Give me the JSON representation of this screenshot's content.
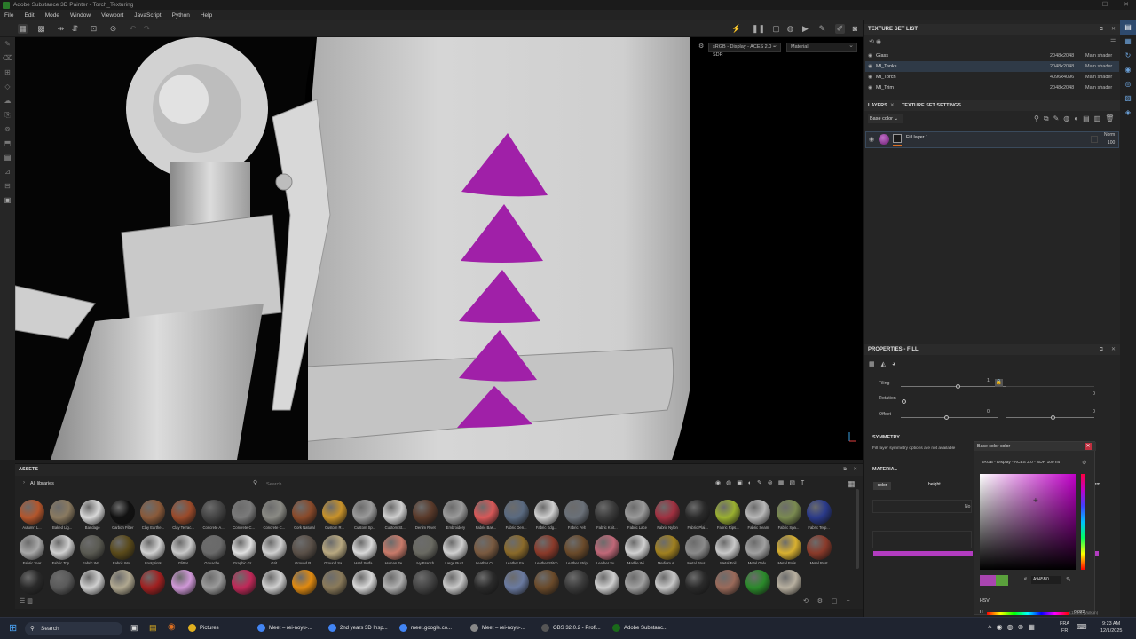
{
  "window": {
    "title": "Adobe Substance 3D Painter - Torch_Texturing",
    "min": "—",
    "max": "☐",
    "close": "✕"
  },
  "menu": [
    "File",
    "Edit",
    "Mode",
    "Window",
    "Viewport",
    "JavaScript",
    "Python",
    "Help"
  ],
  "viewport": {
    "colorspace": "sRGB - Display - ACES 2.0 - SDR",
    "display_mode": "Material",
    "accent_color": "#a020a8"
  },
  "texture_set_list": {
    "title": "TEXTURE SET LIST",
    "items": [
      {
        "name": "Glass",
        "resolution": "2048x2048",
        "shader": "Main shader",
        "selected": false
      },
      {
        "name": "MI_Tanks",
        "resolution": "2048x2048",
        "shader": "Main shader",
        "selected": true
      },
      {
        "name": "MI_Torch",
        "resolution": "4096x4096",
        "shader": "Main shader",
        "selected": false
      },
      {
        "name": "MI_Trim",
        "resolution": "2048x2048",
        "shader": "Main shader",
        "selected": false
      }
    ]
  },
  "layers": {
    "tab_layers": "LAYERS",
    "tab_settings": "TEXTURE SET SETTINGS",
    "channel": "Base color",
    "items": [
      {
        "name": "Fill layer 1",
        "blend": "Norm",
        "opacity": "100"
      }
    ]
  },
  "properties": {
    "title": "PROPERTIES - FILL",
    "tiling_label": "Tiling",
    "tiling_value": "1",
    "rotation_label": "Rotation",
    "rotation_value": "0",
    "offset_label": "Offset",
    "offset_value_x": "0",
    "offset_value_y": "0",
    "extra_value_1": "0",
    "symmetry_title": "SYMMETRY",
    "symmetry_text": "Fill layer symmetry options are not available",
    "material_title": "MATERIAL",
    "channel_color": "color",
    "channel_height": "height",
    "channel_partial": "No",
    "channel_norm": "nrm",
    "base_color_bar": "#b23cc0"
  },
  "color_picker": {
    "title": "Base color color",
    "colorspace": "sRGB - Display - ACES 2.0 - SDR 100 nit",
    "hex": "A945B0",
    "mode": "HSV",
    "h_value": "0.822",
    "swatch_new": "#a945b0",
    "swatch_old": "#5aa03c"
  },
  "assets": {
    "title": "ASSETS",
    "library": "All libraries",
    "search_placeholder": "Search",
    "items": [
      {
        "label": "Autumn L...",
        "color": "#b4562c"
      },
      {
        "label": "Baked Lig...",
        "color": "#8a7a60"
      },
      {
        "label": "Bandage",
        "color": "#d8d8d8"
      },
      {
        "label": "Carbon Fiber",
        "color": "#111111"
      },
      {
        "label": "Clay Earthe...",
        "color": "#8a5a3a"
      },
      {
        "label": "Clay Terrac...",
        "color": "#9a4a2a"
      },
      {
        "label": "Concrete A...",
        "color": "#444444"
      },
      {
        "label": "Concrete C...",
        "color": "#7a7a7a"
      },
      {
        "label": "Concrete C...",
        "color": "#8a8a84"
      },
      {
        "label": "Cork Natural",
        "color": "#8a4a2a"
      },
      {
        "label": "Custom R...",
        "color": "#c8922a"
      },
      {
        "label": "Custom Sp...",
        "color": "#9a9a9a"
      },
      {
        "label": "Custom St...",
        "color": "#cfcfcf"
      },
      {
        "label": "Denim Rivet",
        "color": "#5a3a2a"
      },
      {
        "label": "Embroidery",
        "color": "#9a9a9a"
      },
      {
        "label": "Fabric Bas...",
        "color": "#d85858"
      },
      {
        "label": "Fabric Den...",
        "color": "#5a6a80"
      },
      {
        "label": "Fabric Edg...",
        "color": "#cfcfcf"
      },
      {
        "label": "Fabric Felt",
        "color": "#6a7078"
      },
      {
        "label": "Fabric Knit...",
        "color": "#3a3a3a"
      },
      {
        "label": "Fabric Lace",
        "color": "#9a9a9a"
      },
      {
        "label": "Fabric Nylon",
        "color": "#a03040"
      },
      {
        "label": "Fabric Plai...",
        "color": "#2a2a2a"
      },
      {
        "label": "Fabric Rips...",
        "color": "#9ab030"
      },
      {
        "label": "Fabric Seam",
        "color": "#b8b8b8"
      },
      {
        "label": "Fabric Spa...",
        "color": "#7a8a50"
      },
      {
        "label": "Fabric Terp...",
        "color": "#2a3a8a"
      },
      {
        "label": "Fabric Tear",
        "color": "#a8a8a8"
      },
      {
        "label": "Fabric Top...",
        "color": "#d0d0d0"
      },
      {
        "label": "Fabric Wo...",
        "color": "#5a5a52"
      },
      {
        "label": "Fabric Wo...",
        "color": "#5a4a1a"
      },
      {
        "label": "Footprints",
        "color": "#d0d0d0"
      },
      {
        "label": "Glitter",
        "color": "#c8c8c8"
      },
      {
        "label": "Gouache...",
        "color": "#6a6a6a"
      },
      {
        "label": "Graphic Gr...",
        "color": "#e0e0e0"
      },
      {
        "label": "Grit",
        "color": "#cfcfcf"
      },
      {
        "label": "Ground R...",
        "color": "#5a5048"
      },
      {
        "label": "Ground Sa...",
        "color": "#b8a880"
      },
      {
        "label": "Hard Surfa...",
        "color": "#d8d8d8"
      },
      {
        "label": "Human Fe...",
        "color": "#c87a6a"
      },
      {
        "label": "Ivy Branch",
        "color": "#6a6a62"
      },
      {
        "label": "Large Rust...",
        "color": "#cfcfcf"
      },
      {
        "label": "Leather Cr...",
        "color": "#7a5a40"
      },
      {
        "label": "Leather Fa...",
        "color": "#8a6a2a"
      },
      {
        "label": "Leather Stitch",
        "color": "#8a3a2a"
      },
      {
        "label": "Leather Strip",
        "color": "#6a4a2a"
      },
      {
        "label": "Leather Su...",
        "color": "#c06878"
      },
      {
        "label": "Marble Wi...",
        "color": "#d0d0d0"
      },
      {
        "label": "Medium A...",
        "color": "#a08020"
      },
      {
        "label": "Metal Brus...",
        "color": "#8a8a8a"
      },
      {
        "label": "Metal Foil",
        "color": "#c8c8c8"
      },
      {
        "label": "Metal Galv...",
        "color": "#a0a0a0"
      },
      {
        "label": "Metal Polis...",
        "color": "#d8b030"
      },
      {
        "label": "Metal Rust",
        "color": "#8a3a2a"
      },
      {
        "label": "",
        "color": "#2a2a2a"
      },
      {
        "label": "",
        "color": "#5a5a5a"
      },
      {
        "label": "",
        "color": "#cfcfcf"
      },
      {
        "label": "",
        "color": "#b0a890"
      },
      {
        "label": "",
        "color": "#a02020"
      },
      {
        "label": "",
        "color": "#d098d8"
      },
      {
        "label": "",
        "color": "#9a9a9a"
      },
      {
        "label": "",
        "color": "#c02858"
      },
      {
        "label": "",
        "color": "#cfcfcf"
      },
      {
        "label": "",
        "color": "#e08a10"
      },
      {
        "label": "",
        "color": "#8a7a5a"
      },
      {
        "label": "",
        "color": "#d8d8d8"
      },
      {
        "label": "",
        "color": "#b0b0b0"
      },
      {
        "label": "",
        "color": "#444444"
      },
      {
        "label": "",
        "color": "#c8c8c8"
      },
      {
        "label": "",
        "color": "#2a2a2a"
      },
      {
        "label": "",
        "color": "#6a7aa0"
      },
      {
        "label": "",
        "color": "#6a4a2a"
      },
      {
        "label": "",
        "color": "#3a3a3a"
      },
      {
        "label": "",
        "color": "#cfcfcf"
      },
      {
        "label": "",
        "color": "#a0a0a0"
      },
      {
        "label": "",
        "color": "#c8c8c8"
      },
      {
        "label": "",
        "color": "#2a2a2a"
      },
      {
        "label": "",
        "color": "#9a6a5a"
      },
      {
        "label": "",
        "color": "#2a8a2a"
      },
      {
        "label": "",
        "color": "#b8b0a0"
      }
    ]
  },
  "status": {
    "version": "v.11.1.0 (Vulkan)"
  },
  "taskbar": {
    "search": "Search",
    "items": [
      {
        "label": "Pictures",
        "color": "#e0b020"
      },
      {
        "label": "Meet – rei-noyu-...",
        "color": "#4285f4"
      },
      {
        "label": "2nd years 3D Insp...",
        "color": "#4285f4"
      },
      {
        "label": "meet.google.co...",
        "color": "#4285f4"
      },
      {
        "label": "Meet – rei-noyu-...",
        "color": "#888888"
      },
      {
        "label": "OBS 32.0.2 - Profi...",
        "color": "#555555"
      },
      {
        "label": "Adobe Substanc...",
        "color": "#1a6a1a"
      }
    ],
    "lang_top": "FRA",
    "lang_bot": "FR",
    "time": "9:23 AM",
    "date": "12/1/2025"
  }
}
